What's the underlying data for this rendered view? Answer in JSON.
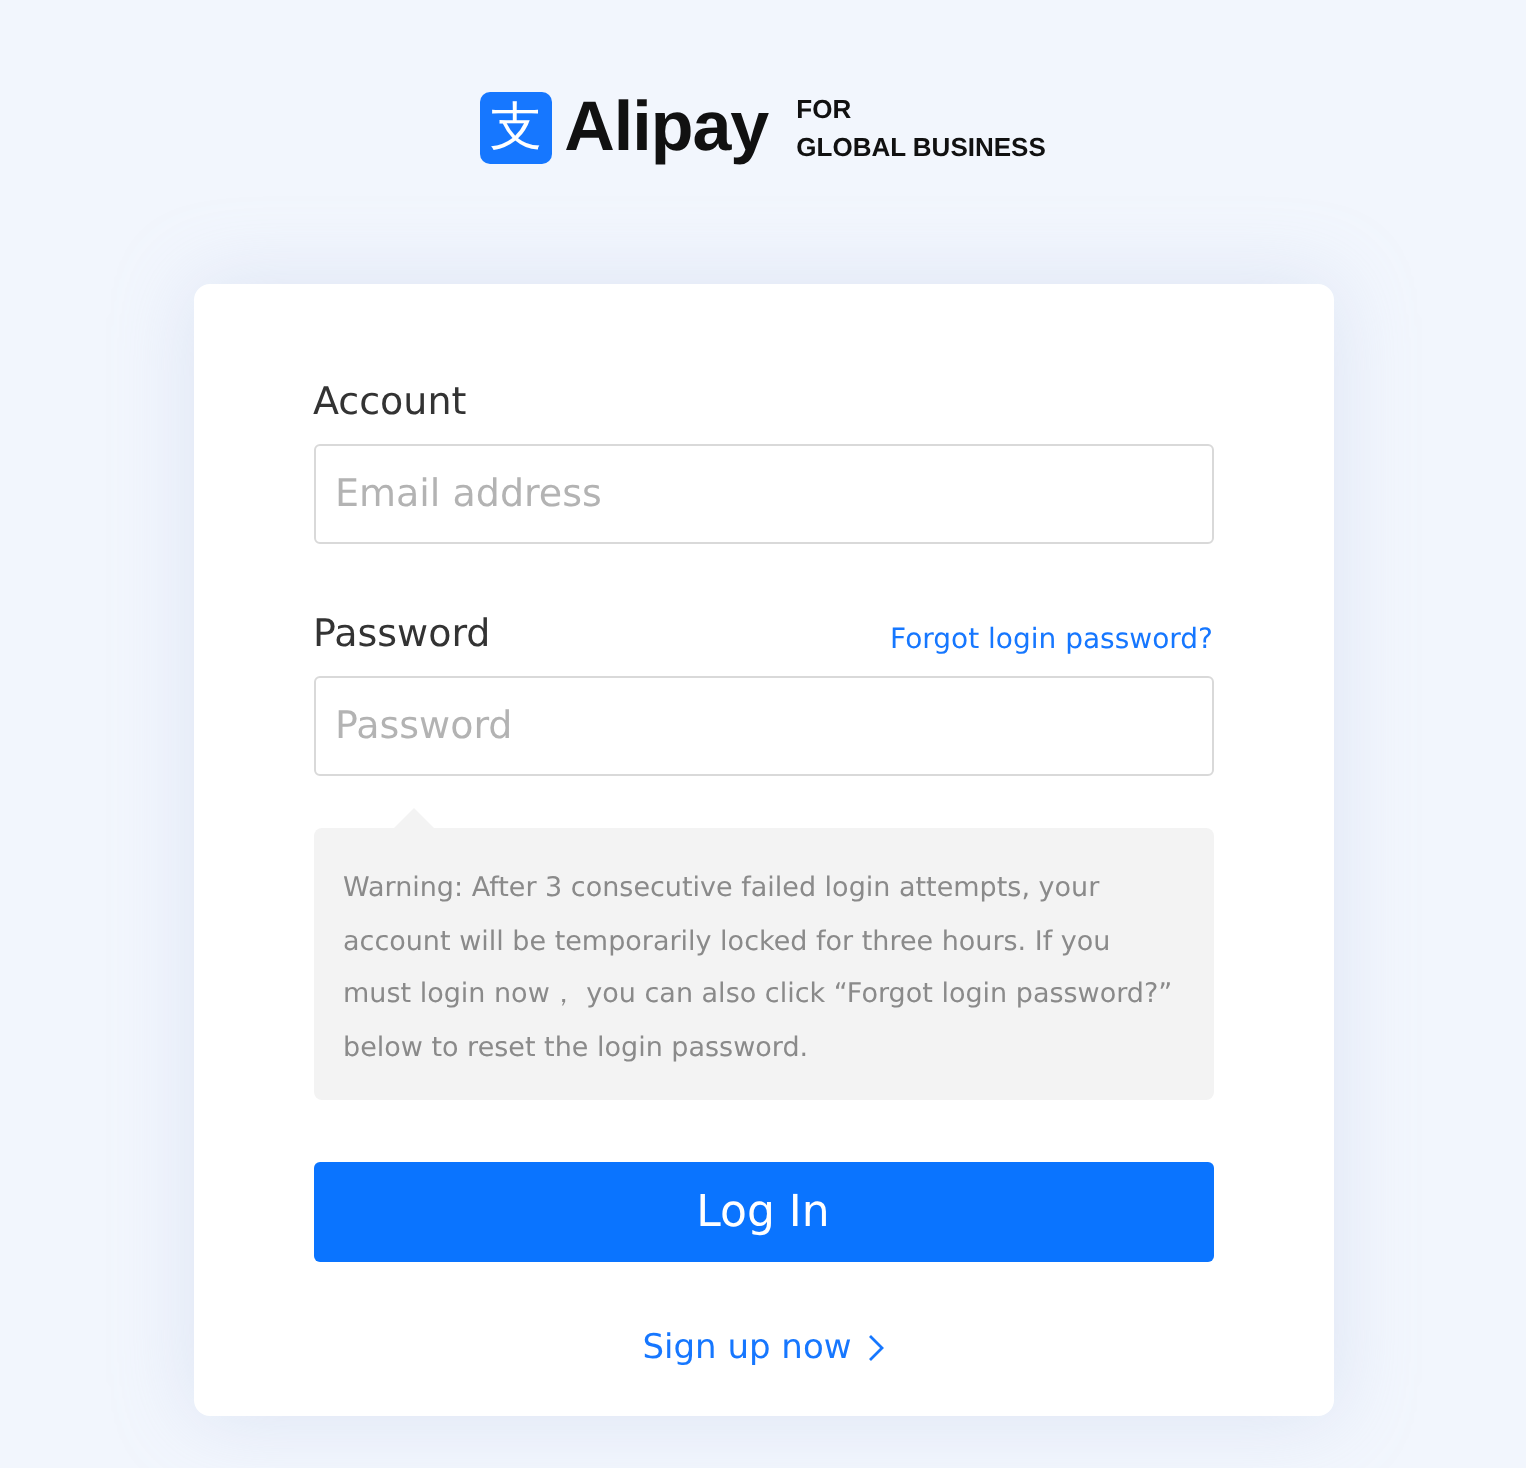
{
  "logo": {
    "mark": "支",
    "name": "Alipay",
    "tagline_1": "FOR",
    "tagline_2": "GLOBAL BUSINESS"
  },
  "form": {
    "account": {
      "label": "Account",
      "placeholder": "Email address"
    },
    "password": {
      "label": "Password",
      "placeholder": "Password",
      "link": "Forgot login password?"
    },
    "warning": "Warning: After 3 consecutive failed login attempts, your account will be temporarily locked for three hours. If you must login now，  you can also click “Forgot login password?” below to reset the login password.",
    "submit": "Log In",
    "signup": "Sign up now"
  }
}
